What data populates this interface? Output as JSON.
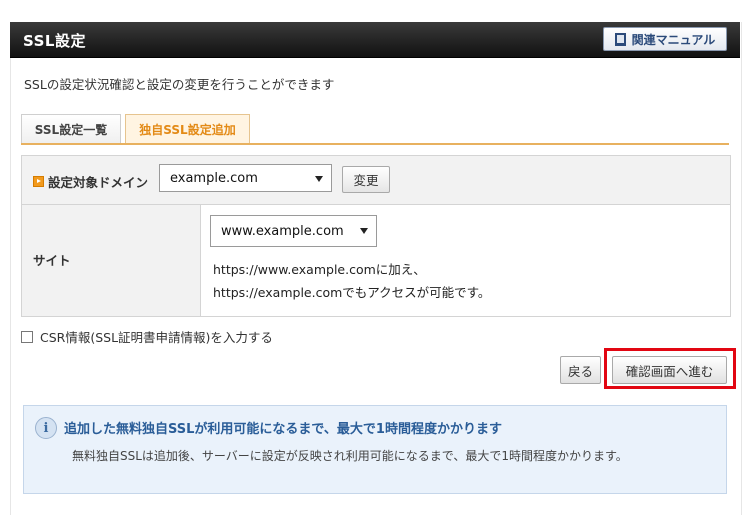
{
  "header": {
    "title": "SSL設定",
    "manual_button": "関連マニュアル",
    "manual_icon": "book-icon"
  },
  "description": "SSLの設定状況確認と設定の変更を行うことができます",
  "tabs": [
    {
      "label": "SSL設定一覧",
      "active": false
    },
    {
      "label": "独自SSL設定追加",
      "active": true
    }
  ],
  "form": {
    "domain_label": "設定対象ドメイン",
    "domain_value": "example.com",
    "change_button": "変更",
    "site_label": "サイト",
    "site_value": "www.example.com",
    "site_note_line1": "https://www.example.comに加え、",
    "site_note_line2": "https://example.comでもアクセスが可能です。"
  },
  "csr_checkbox": {
    "label": "CSR情報(SSL証明書申請情報)を入力する",
    "checked": false
  },
  "buttons": {
    "back": "戻る",
    "confirm": "確認画面へ進む"
  },
  "info": {
    "icon": "info-icon",
    "title": "追加した無料独自SSLが利用可能になるまで、最大で1時間程度かかります",
    "body": "無料独自SSLは追加後、サーバーに設定が反映され利用可能になるまで、最大で1時間程度かかります。"
  },
  "colors": {
    "highlight": "#e20612",
    "active_tab_text": "#e38a16",
    "info_title": "#2a5d98"
  }
}
